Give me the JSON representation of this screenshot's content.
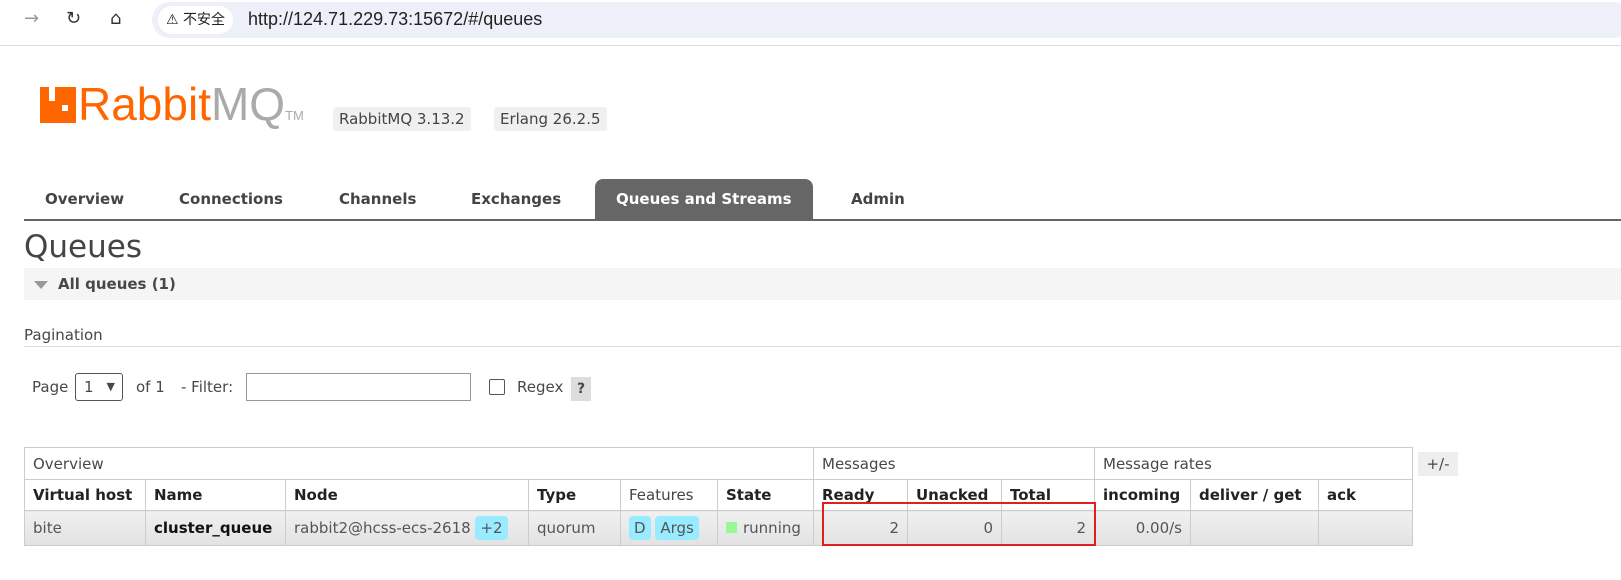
{
  "browser": {
    "back_icon": "arrow-right",
    "reload_icon": "reload",
    "home_icon": "home",
    "insecure_label": "不安全",
    "url": "http://124.71.229.73:15672/#/queues"
  },
  "header": {
    "logo_rabbit": "Rabbit",
    "logo_mq": "MQ",
    "logo_tm": "TM",
    "version": "RabbitMQ 3.13.2",
    "erlang": "Erlang 26.2.5"
  },
  "tabs": [
    {
      "label": "Overview"
    },
    {
      "label": "Connections"
    },
    {
      "label": "Channels"
    },
    {
      "label": "Exchanges"
    },
    {
      "label": "Queues and Streams",
      "active": true
    },
    {
      "label": "Admin"
    }
  ],
  "page_title": "Queues",
  "section_title": "All queues (1)",
  "pagination": {
    "label": "Pagination",
    "page_label": "Page",
    "page_value": "1",
    "of_label": "of 1",
    "filter_label": "- Filter:",
    "filter_value": "",
    "regex_label": "Regex",
    "regex_checked": false,
    "help": "?"
  },
  "table": {
    "groups": [
      "Overview",
      "Messages",
      "Message rates"
    ],
    "columns": [
      "Virtual host",
      "Name",
      "Node",
      "Type",
      "Features",
      "State",
      "Ready",
      "Unacked",
      "Total",
      "incoming",
      "deliver / get",
      "ack"
    ],
    "rows": [
      {
        "vhost": "bite",
        "name": "cluster_queue",
        "node": "rabbit2@hcss-ecs-2618",
        "node_extra": "+2",
        "type": "quorum",
        "features": [
          "D",
          "Args"
        ],
        "state": "running",
        "ready": "2",
        "unacked": "0",
        "total": "2",
        "incoming": "0.00/s",
        "deliver_get": "",
        "ack": ""
      }
    ],
    "toggle_columns": "+/-"
  },
  "colors": {
    "accent": "#ff6600",
    "active_tab": "#666666",
    "pill": "#99ebff",
    "running": "#98f898",
    "highlight_box": "#e02020"
  }
}
